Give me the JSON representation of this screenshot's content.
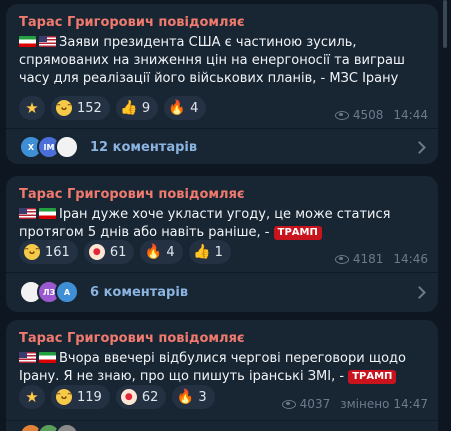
{
  "messages": [
    {
      "sender": "Тарас Григорович повідомляє",
      "text": "Заяви президента США є частиною зусиль, спрямованих на зниження цін на енергоносії та виграш часу для реалізації його військових планів, - МЗС Ірану",
      "flags": [
        "flag-ir",
        "flag-us"
      ],
      "reactions": [
        {
          "icon": "star-icon",
          "count": ""
        },
        {
          "icon": "grinning-face-icon",
          "count": "152"
        },
        {
          "icon": "thumbs-up-icon",
          "count": "9"
        },
        {
          "icon": "fire-icon",
          "count": "4"
        }
      ],
      "views": "4508",
      "time": "14:44",
      "edited": "",
      "comments": {
        "label": "12 коментарів",
        "avatars": [
          "X",
          "IM",
          ""
        ]
      }
    },
    {
      "sender": "Тарас Григорович повідомляє",
      "text": "Іран дуже хоче укласти угоду, це може статися протягом 5 днів або навіть раніше, -",
      "badge": "ТРАМП",
      "flags": [
        "flag-us",
        "flag-ir"
      ],
      "reactions": [
        {
          "icon": "grinning-face-icon",
          "count": "161"
        },
        {
          "icon": "clown-face-icon",
          "count": "61"
        },
        {
          "icon": "fire-icon",
          "count": "4"
        },
        {
          "icon": "thumbs-up-icon",
          "count": "1"
        }
      ],
      "views": "4181",
      "time": "14:46",
      "edited": "",
      "comments": {
        "label": "6 коментарів",
        "avatars": [
          "",
          "ЛЗ",
          "А"
        ]
      }
    },
    {
      "sender": "Тарас Григорович повідомляє",
      "text": "Вчора ввечері відбулися чергові переговори щодо Ірану. Я не знаю, про що пишуть іранські ЗМІ, -",
      "badge": "ТРАМП",
      "flags": [
        "flag-us",
        "flag-ir"
      ],
      "reactions": [
        {
          "icon": "star-icon",
          "count": ""
        },
        {
          "icon": "grinning-face-icon",
          "count": "119"
        },
        {
          "icon": "clown-face-icon",
          "count": "62"
        },
        {
          "icon": "fire-icon",
          "count": "3"
        }
      ],
      "views": "4037",
      "time": "14:47",
      "edited": "змінено"
    }
  ],
  "colors": {
    "background": "#0e1621",
    "bubble": "#182533",
    "sender": "#f07a6d",
    "link": "#8bb4e0",
    "badge": "#c9141e"
  }
}
